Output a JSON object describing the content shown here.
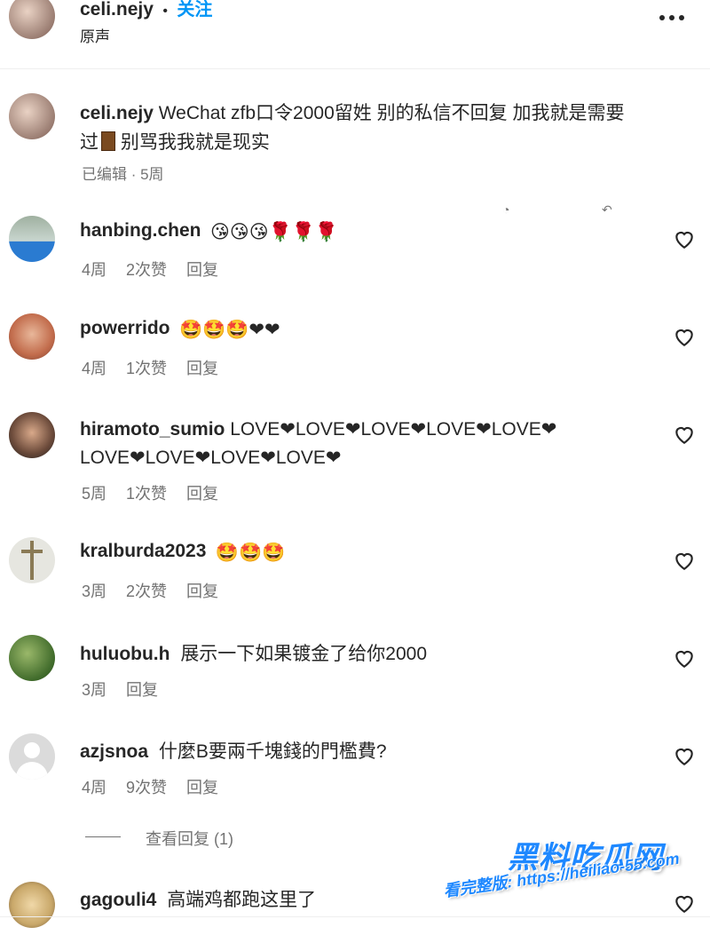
{
  "post_header": {
    "username": "celi.nejy",
    "dot": "•",
    "follow_label": "关注",
    "audio_label": "原声",
    "more_icon": "more-horizontal-icon"
  },
  "caption": {
    "username": "celi.nejy",
    "text_line1": "WeChat zfb口令2000留姓 别的私信不回复 加我就是需要",
    "text_line2_a": "过",
    "text_line2_b": " 别骂我我就是现实",
    "meta": "已编辑 · 5周"
  },
  "comments": [
    {
      "username": "hanbing.chen",
      "emoji": "😘😘😘🌹🌹🌹",
      "time": "4周",
      "likes": "2次赞",
      "reply": "回复"
    },
    {
      "username": "powerrido",
      "emoji": "🤩🤩🤩❤❤",
      "time": "4周",
      "likes": "1次赞",
      "reply": "回复"
    },
    {
      "username": "hiramoto_sumio",
      "line1": "LOVE❤LOVE❤LOVE❤LOVE❤LOVE❤",
      "line2": "LOVE❤LOVE❤LOVE❤LOVE❤",
      "time": "5周",
      "likes": "1次赞",
      "reply": "回复"
    },
    {
      "username": "kralburda2023",
      "emoji": "🤩🤩🤩",
      "time": "3周",
      "likes": "2次赞",
      "reply": "回复"
    },
    {
      "username": "huluobu.h",
      "text": "展示一下如果镀金了给你2000",
      "time": "3周",
      "reply": "回复"
    },
    {
      "username": "azjsnoa",
      "text": "什麼B要兩千塊錢的門檻費?",
      "time": "4周",
      "likes": "9次赞",
      "reply": "回复"
    },
    {
      "username": "gagouli4",
      "text": "高端鸡都跑这里了"
    }
  ],
  "view_replies": "查看回复 (1)",
  "watermark": {
    "title": "黑料吃瓜网",
    "url": "看完整版: https://heiliao-55.com"
  },
  "colors": {
    "follow": "#0095f6",
    "muted": "#737373",
    "watermark": "#1e88ff"
  }
}
